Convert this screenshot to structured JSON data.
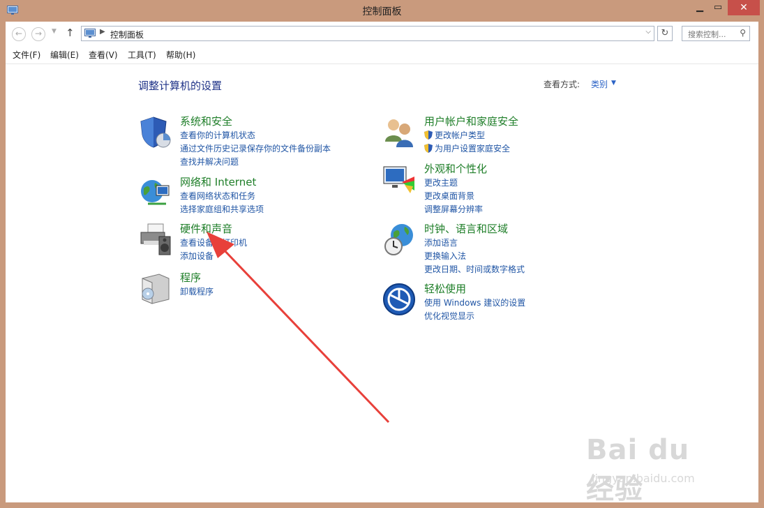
{
  "window": {
    "title": "控制面板"
  },
  "address": {
    "path": "控制面板",
    "search_placeholder": "搜索控制..."
  },
  "menu": [
    "文件(F)",
    "编辑(E)",
    "查看(V)",
    "工具(T)",
    "帮助(H)"
  ],
  "content": {
    "heading": "调整计算机的设置",
    "view_by_label": "查看方式:",
    "view_by_value": "类别"
  },
  "categories": [
    {
      "title": "系统和安全",
      "links": [
        "查看你的计算机状态",
        "通过文件历史记录保存你的文件备份副本",
        "查找并解决问题"
      ]
    },
    {
      "title": "网络和 Internet",
      "links": [
        "查看网络状态和任务",
        "选择家庭组和共享选项"
      ]
    },
    {
      "title": "硬件和声音",
      "links": [
        "查看设备和打印机",
        "添加设备"
      ]
    },
    {
      "title": "程序",
      "links": [
        "卸载程序"
      ]
    },
    {
      "title": "用户帐户和家庭安全",
      "links": [
        "更改帐户类型",
        "为用户设置家庭安全"
      ]
    },
    {
      "title": "外观和个性化",
      "links": [
        "更改主题",
        "更改桌面背景",
        "调整屏幕分辨率"
      ]
    },
    {
      "title": "时钟、语言和区域",
      "links": [
        "添加语言",
        "更换输入法",
        "更改日期、时间或数字格式"
      ]
    },
    {
      "title": "轻松使用",
      "links": [
        "使用 Windows 建议的设置",
        "优化视觉显示"
      ]
    }
  ],
  "watermark": {
    "logo": "Bai du 经验",
    "url": "jingyan.baidu.com"
  },
  "colors": {
    "frame": "#c99a7d",
    "close": "#c7504a",
    "category_title": "#1e7e28",
    "link": "#2156a5",
    "arrow": "#e8403a"
  }
}
